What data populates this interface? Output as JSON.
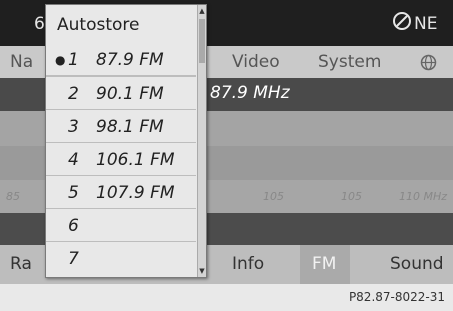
{
  "status": {
    "left_fragment": "6",
    "direction": "NE",
    "compass_icon": "compass-icon"
  },
  "navbar": {
    "left_fragment": "Na",
    "items": [
      "Video",
      "System"
    ],
    "globe_icon": "globe-icon"
  },
  "frequency_display": "87.9 MHz",
  "scale": {
    "ticks": [
      "85",
      "105",
      "105",
      "110 MHz"
    ]
  },
  "bottombar": {
    "left_fragment": "Ra",
    "items": [
      {
        "label": "Info"
      },
      {
        "label": "FM",
        "active": true
      },
      {
        "label": "Sound"
      }
    ]
  },
  "dropdown": {
    "title": "Autostore",
    "selected_index": 0,
    "items": [
      {
        "num": "1",
        "freq": "87.9 FM"
      },
      {
        "num": "2",
        "freq": "90.1 FM"
      },
      {
        "num": "3",
        "freq": "98.1 FM"
      },
      {
        "num": "4",
        "freq": "106.1 FM"
      },
      {
        "num": "5",
        "freq": "107.9 FM"
      },
      {
        "num": "6",
        "freq": ""
      },
      {
        "num": "7",
        "freq": ""
      }
    ]
  },
  "footer": {
    "page_id": "P82.87-8022-31"
  }
}
